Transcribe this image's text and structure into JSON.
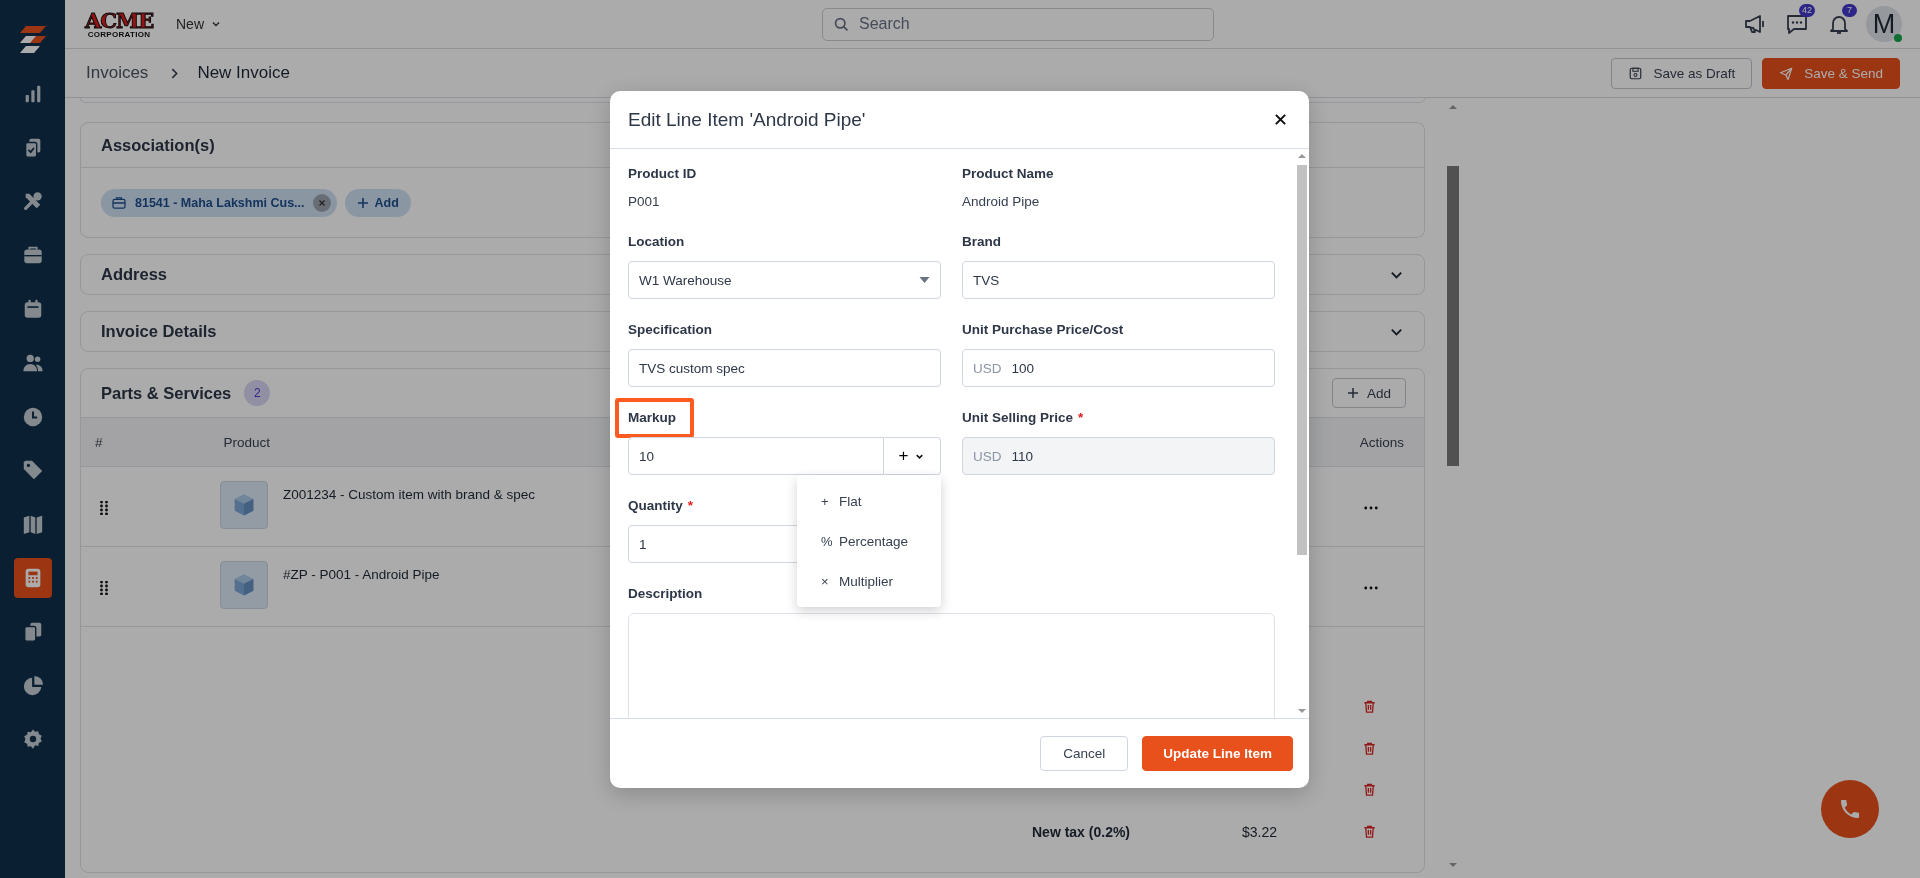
{
  "sidebar": {
    "items": [
      {
        "kind": "chart",
        "selected": false
      },
      {
        "kind": "clipboard",
        "selected": false
      },
      {
        "kind": "tools",
        "selected": false
      },
      {
        "kind": "briefcase",
        "selected": false
      },
      {
        "kind": "calendar",
        "selected": false
      },
      {
        "kind": "users",
        "selected": false
      },
      {
        "kind": "clock",
        "selected": false
      },
      {
        "kind": "tag",
        "selected": false
      },
      {
        "kind": "map",
        "selected": false
      },
      {
        "kind": "calculator",
        "selected": true
      },
      {
        "kind": "documents",
        "selected": false
      },
      {
        "kind": "pie",
        "selected": false
      },
      {
        "kind": "gear",
        "selected": false
      }
    ]
  },
  "topbar": {
    "logo": {
      "name": "ACME",
      "tagline": "CORPORATION"
    },
    "new_menu": "New",
    "search": {
      "placeholder": "Search"
    },
    "icons": [
      {
        "kind": "megaphone"
      },
      {
        "kind": "chat",
        "badge": "42"
      },
      {
        "kind": "bell",
        "badge": "7"
      }
    ],
    "avatar": {
      "initial": "M",
      "online": true
    }
  },
  "breadcrumb": [
    "Invoices",
    "New Invoice"
  ],
  "page_actions": [
    {
      "label": "Save as Draft",
      "kind": "secondary"
    },
    {
      "label": "Save & Send",
      "kind": "primary"
    }
  ],
  "associations": {
    "title": "Association(s)",
    "chips": [
      "81541 - Maha Lakshmi Cus..."
    ],
    "add_label": "Add"
  },
  "sections": [
    {
      "title": "Address",
      "expanded": false
    },
    {
      "title": "Invoice Details",
      "expanded": false
    }
  ],
  "parts": {
    "title": "Parts & Services",
    "count": "2",
    "add_label": "Add",
    "columns": [
      "#",
      "Product",
      "Actions"
    ],
    "rows": [
      {
        "product": "Z001234 - Custom item with brand & spec"
      },
      {
        "product": "#ZP - P001 - Android Pipe"
      }
    ],
    "taxes": [
      {
        "label": "New tax (0.2%)",
        "amount": "$3.22"
      }
    ]
  },
  "modal": {
    "title": "Edit Line Item 'Android Pipe'",
    "required_mark": "*",
    "fields": [
      {
        "kind": "static",
        "label": "Product ID",
        "value": "P001",
        "required": false
      },
      {
        "kind": "static",
        "label": "Product Name",
        "value": "Android Pipe",
        "required": false
      },
      {
        "kind": "select",
        "label": "Location",
        "value": "W1 Warehouse",
        "required": false
      },
      {
        "kind": "text",
        "label": "Brand",
        "value": "TVS",
        "required": false
      },
      {
        "kind": "text",
        "label": "Specification",
        "value": "TVS custom spec",
        "required": false
      },
      {
        "kind": "money",
        "label": "Unit Purchase Price/Cost",
        "currency": "USD",
        "value": "100",
        "required": false,
        "disabled": false
      },
      {
        "kind": "markup",
        "label": "Markup",
        "value": "10",
        "operator": "+",
        "required": false,
        "highlighted": true
      },
      {
        "kind": "money",
        "label": "Unit Selling Price",
        "currency": "USD",
        "value": "110",
        "required": true,
        "disabled": true
      },
      {
        "kind": "text",
        "label": "Quantity",
        "value": "1",
        "required": true
      },
      {
        "kind": "textarea",
        "label": "Description",
        "required": false
      }
    ],
    "markup_menu": {
      "open": true,
      "options": [
        {
          "symbol": "+",
          "label": "Flat"
        },
        {
          "symbol": "%",
          "label": "Percentage"
        },
        {
          "symbol": "×",
          "label": "Multiplier"
        }
      ]
    },
    "buttons": [
      {
        "label": "Cancel",
        "kind": "secondary"
      },
      {
        "label": "Update Line Item",
        "kind": "primary"
      }
    ]
  }
}
